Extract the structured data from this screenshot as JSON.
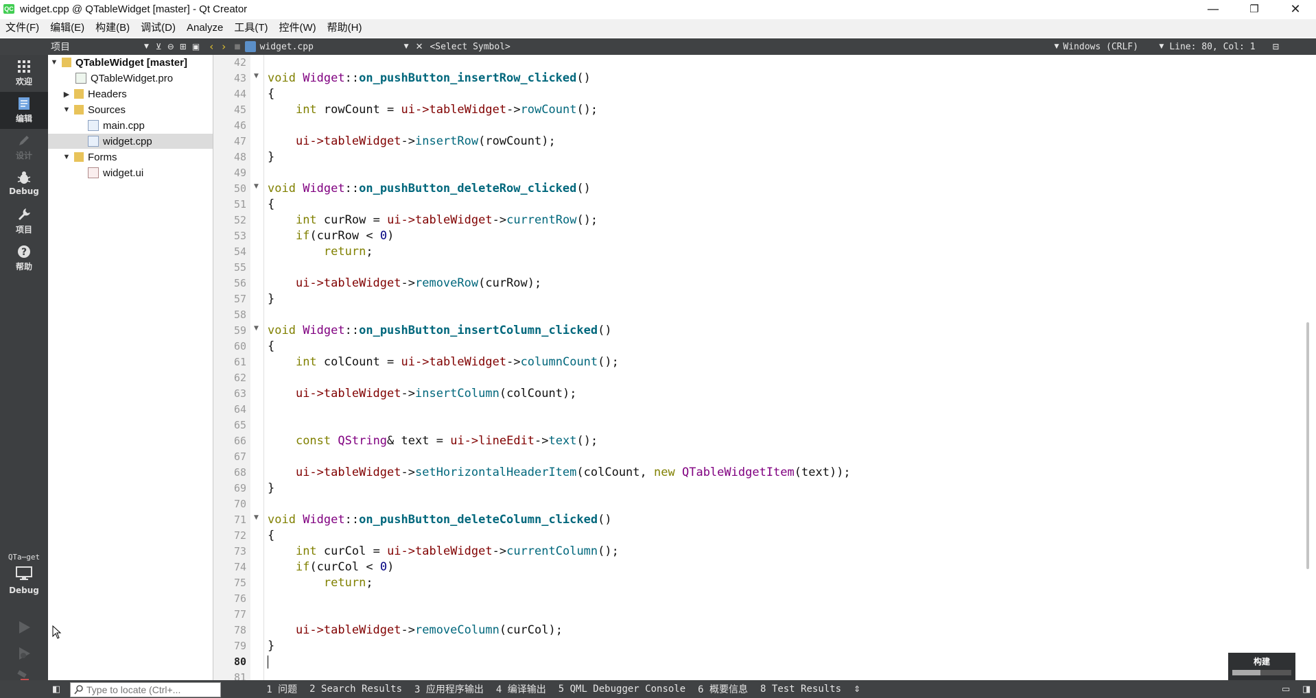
{
  "window": {
    "title": "widget.cpp @ QTableWidget [master] - Qt Creator",
    "app_icon_text": "QC",
    "minimize": "—",
    "maximize": "❐",
    "close": "✕"
  },
  "menu": [
    "文件(F)",
    "编辑(E)",
    "构建(B)",
    "调试(D)",
    "Analyze",
    "工具(T)",
    "控件(W)",
    "帮助(H)"
  ],
  "toolbar": {
    "project_combo": "项目",
    "file_combo": "widget.cpp",
    "symbol_combo": "<Select Symbol>",
    "line_endings": "Windows (CRLF)",
    "position": "Line: 80, Col: 1"
  },
  "modes": {
    "welcome": "欢迎",
    "edit": "编辑",
    "design": "设计",
    "debug": "Debug",
    "projects": "项目",
    "help": "帮助",
    "kit_project": "QTa⋯get",
    "kit_build": "Debug"
  },
  "tree": {
    "project": "QTableWidget [master]",
    "pro_file": "QTableWidget.pro",
    "headers": "Headers",
    "sources": "Sources",
    "main_cpp": "main.cpp",
    "widget_cpp": "widget.cpp",
    "forms": "Forms",
    "widget_ui": "widget.ui"
  },
  "line_numbers": [
    "42",
    "43",
    "44",
    "45",
    "46",
    "47",
    "48",
    "49",
    "50",
    "51",
    "52",
    "53",
    "54",
    "55",
    "56",
    "57",
    "58",
    "59",
    "60",
    "61",
    "62",
    "63",
    "64",
    "65",
    "66",
    "67",
    "68",
    "69",
    "70",
    "71",
    "72",
    "73",
    "74",
    "75",
    "76",
    "77",
    "78",
    "79",
    "80",
    "81"
  ],
  "current_line": "80",
  "code": {
    "void": "void",
    "widget": "Widget",
    "scope": "::",
    "fn_insertRow": "on_pushButton_insertRow_clicked",
    "fn_deleteRow": "on_pushButton_deleteRow_clicked",
    "fn_insertColumn": "on_pushButton_insertColumn_clicked",
    "fn_deleteColumn": "on_pushButton_deleteColumn_clicked",
    "parens": "()",
    "open_brace": "{",
    "close_brace": "}",
    "int": "int",
    "if": "if",
    "return": "return",
    "const": "const",
    "new": "new",
    "qstring": "QString",
    "qtwi": "QTableWidgetItem",
    "ui_arrow": "ui->",
    "tableWidget": "tableWidget",
    "lineEdit": "lineEdit",
    "arrow": "->",
    "rowCount_var": "rowCount",
    "curRow": "curRow",
    "colCount": "colCount",
    "curCol": "curCol",
    "text_var": "text",
    "m_rowCount": "rowCount",
    "m_insertRow": "insertRow",
    "m_currentRow": "currentRow",
    "m_removeRow": "removeRow",
    "m_columnCount": "columnCount",
    "m_insertColumn": "insertColumn",
    "m_text": "text",
    "m_setHeader": "setHorizontalHeaderItem",
    "m_currentColumn": "currentColumn",
    "m_removeColumn": "removeColumn",
    "zero": "0"
  },
  "status": {
    "locator_placeholder": "Type to locate (Ctrl+...",
    "tabs": [
      "1 问题",
      "2 Search Results",
      "3 应用程序输出",
      "4 编译输出",
      "5 QML Debugger Console",
      "6 概要信息",
      "8 Test Results"
    ],
    "build_label": "构建"
  },
  "colors": {
    "keyword": "#808000",
    "type": "#800080",
    "function_decl": "#00677c",
    "member": "#800000",
    "number": "#000080",
    "dark_panel": "#404244"
  }
}
